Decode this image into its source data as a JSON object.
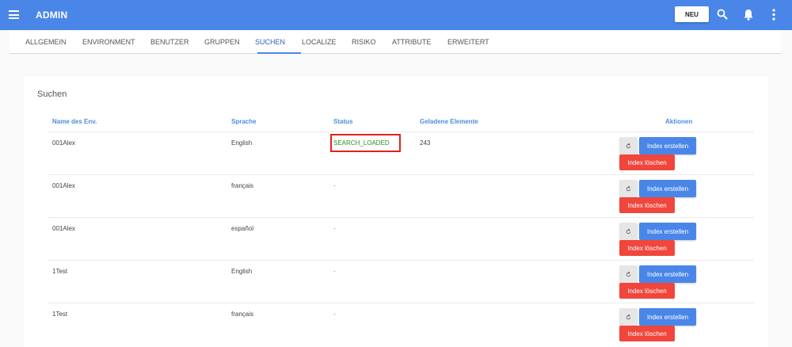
{
  "header": {
    "title": "ADMIN",
    "new_button_label": "NEU",
    "icons": [
      "menu-icon",
      "search-icon",
      "bell-icon",
      "more-vert-icon"
    ],
    "accent_color": "#4a86e8"
  },
  "tabs": [
    {
      "label": "ALLGEMEIN",
      "active": false
    },
    {
      "label": "ENVIRONMENT",
      "active": false
    },
    {
      "label": "BENUTZER",
      "active": false
    },
    {
      "label": "GRUPPEN",
      "active": false
    },
    {
      "label": "SUCHEN",
      "active": true
    },
    {
      "label": "LOCALIZE",
      "active": false
    },
    {
      "label": "RISIKO",
      "active": false
    },
    {
      "label": "ATTRIBUTE",
      "active": false
    },
    {
      "label": "ERWEITERT",
      "active": false
    }
  ],
  "section": {
    "title": "Suchen",
    "columns": {
      "env": "Name des Env.",
      "lang": "Sprache",
      "status": "Status",
      "count": "Geladene Elemente",
      "actions": "Aktionen"
    },
    "rows": [
      {
        "env": "001Alex",
        "lang": "English",
        "status": "SEARCH_LOADED",
        "count": "243"
      },
      {
        "env": "001Alex",
        "lang": "français",
        "status": "-",
        "count": ""
      },
      {
        "env": "001Alex",
        "lang": "español",
        "status": "-",
        "count": ""
      },
      {
        "env": "1Test",
        "lang": "English",
        "status": "-",
        "count": ""
      },
      {
        "env": "1Test",
        "lang": "français",
        "status": "-",
        "count": ""
      }
    ],
    "create_label": "Index erstellen",
    "delete_label": "Index löschen",
    "status_loaded_color": "#2e8b2e",
    "delete_color": "#f0463c",
    "highlight_color": "#e02020"
  }
}
